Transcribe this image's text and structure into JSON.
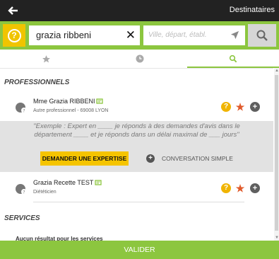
{
  "header": {
    "recipients_label": "Destinataires"
  },
  "search": {
    "query": "grazia ribbeni",
    "location_placeholder": "Ville, départ, établ."
  },
  "tabs": [
    {
      "name": "favorites",
      "icon": "star-icon"
    },
    {
      "name": "history",
      "icon": "clock-icon"
    },
    {
      "name": "search",
      "icon": "search-icon",
      "active": true
    }
  ],
  "sections": {
    "professionals_title": "PROFESSIONNELS",
    "services_title": "SERVICES",
    "services_empty": "Aucun résultat pour les services"
  },
  "results": [
    {
      "name": "Mme Grazia RIBBENI",
      "subtitle": "Autre professionnel - 69008 LYON"
    },
    {
      "name": "Grazia Recette TEST",
      "subtitle": "Diététicien"
    }
  ],
  "expert": {
    "text_line1": "\"Exemple : Expert en ____ je réponds à des demandes d'avis dans le",
    "text_line2": "département ____ et je réponds dans un délai maximal de ___ jours\"",
    "button_label": "DEMANDER UNE EXPERTISE",
    "conversation_label": "CONVERSATION SIMPLE"
  },
  "footer": {
    "validate_label": "VALIDER"
  },
  "colors": {
    "accent_green": "#8cc63f",
    "accent_yellow": "#f5c400",
    "star_orange": "#e05a2b",
    "dark_bar": "#222222"
  }
}
